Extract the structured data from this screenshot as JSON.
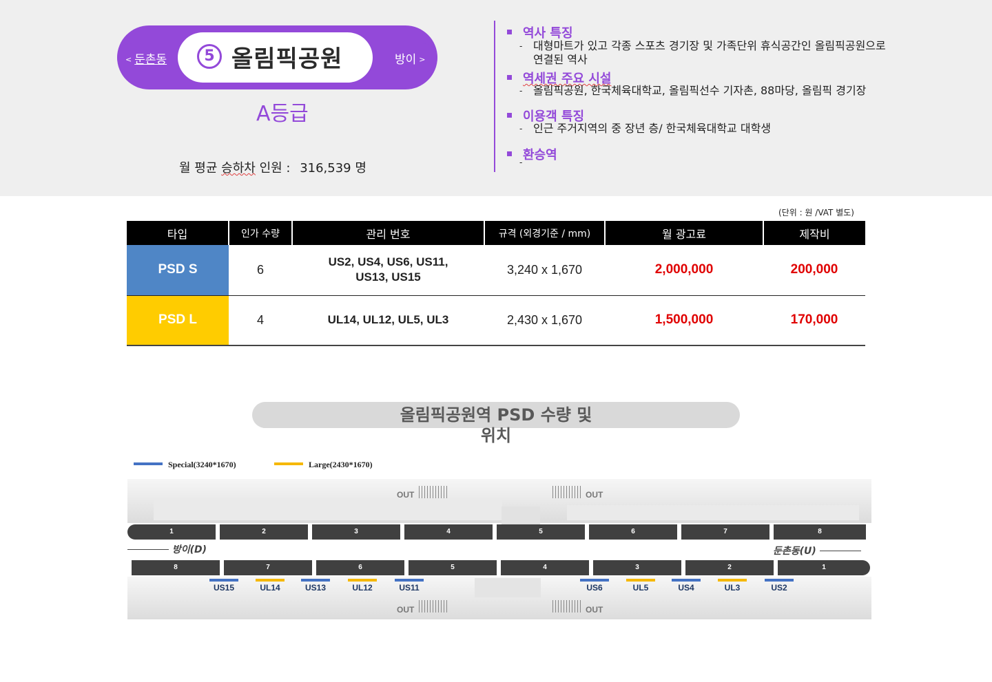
{
  "station": {
    "number": "5",
    "name": "올림픽공원",
    "prev": "둔촌동",
    "next": "방이",
    "grade": "A등급",
    "monthly_label": "월 평균",
    "monthly_label_u": "승하차",
    "monthly_label2": "인원 :",
    "monthly_value": "316,539 명"
  },
  "features": [
    {
      "title": "역사 특징",
      "lines": [
        "대형마트가 있고 각종 스포츠 경기장 및 가족단위 휴식공간인 올림픽공원으로",
        "연결된 역사"
      ]
    },
    {
      "title": "역세권 주요 시설",
      "lines": [
        "올림픽공원, 한국체육대학교, 올림픽선수 기자촌, 88마당, 올림픽 경기장"
      ]
    },
    {
      "title": "이용객 특징",
      "lines": [
        "인근 주거지역의 중 장년 층/ 한국체육대학교 대학생"
      ]
    },
    {
      "title": "환승역",
      "lines": [
        ""
      ]
    }
  ],
  "table": {
    "unit_note": "(단위 : 원 /VAT 별도)",
    "headers": [
      "타입",
      "인가 수량",
      "관리 번호",
      "규격 (외경기준 / mm)",
      "월 광고료",
      "제작비"
    ],
    "rows": [
      {
        "type": "PSD S",
        "qty": "6",
        "ids_1": "US2, US4, US6, US11,",
        "ids_2": "US13, US15",
        "size": "3,240 x 1,670",
        "fee": "2,000,000",
        "cost": "200,000"
      },
      {
        "type": "PSD L",
        "qty": "4",
        "ids_1": "UL14, UL12, UL5, UL3",
        "ids_2": "",
        "size": "2,430 x 1,670",
        "fee": "1,500,000",
        "cost": "170,000"
      }
    ]
  },
  "banner": {
    "line1": "올림픽공원역 PSD 수량 및",
    "line2": "위치"
  },
  "legend": [
    {
      "label": "Special(3240*1670)",
      "color": "#4472c4"
    },
    {
      "label": "Large(2430*1670)",
      "color": "#f5b800"
    }
  ],
  "map": {
    "out": "OUT",
    "dir_left": "방이(D)",
    "dir_right": "둔촌동(U)",
    "top_cars": [
      "1",
      "2",
      "3",
      "4",
      "5",
      "6",
      "7",
      "8"
    ],
    "bottom_cars": [
      "8",
      "7",
      "6",
      "5",
      "4",
      "3",
      "2",
      "1"
    ],
    "markers": [
      {
        "label": "US15",
        "kind": "s"
      },
      {
        "label": "UL14",
        "kind": "l"
      },
      {
        "label": "US13",
        "kind": "s"
      },
      {
        "label": "UL12",
        "kind": "l"
      },
      {
        "label": "US11",
        "kind": "s"
      },
      {
        "label": "US6",
        "kind": "s"
      },
      {
        "label": "UL5",
        "kind": "l"
      },
      {
        "label": "US4",
        "kind": "s"
      },
      {
        "label": "UL3",
        "kind": "l"
      },
      {
        "label": "US2",
        "kind": "s"
      }
    ]
  }
}
